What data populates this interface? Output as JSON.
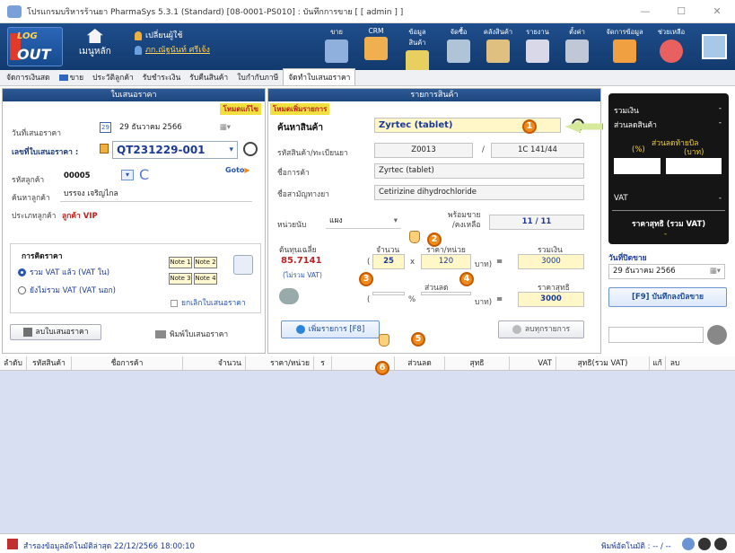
{
  "window": {
    "title": "โปรแกรมบริหารร้านยา PharmaSys 5.3.1 (Standard) [08-0001-PS010] : บันทึกการขาย [ [ admin ] ]",
    "min": "—",
    "max": "☐",
    "close": "✕"
  },
  "toolbar": {
    "logout_top": "LOG",
    "logout_bottom": "OUT",
    "home_label": "เมนูหลัก",
    "change_user": "เปลี่ยนผู้ใช้",
    "user_name": "ภก.ณัฐนันท์ ศรีเจ้ง",
    "items": [
      "ขาย",
      "CRM",
      "ข้อมูลสินค้า",
      "จัดซื้อ",
      "คลังสินค้า",
      "รายงาน",
      "ตั้งค่า",
      "จัดการข้อมูล",
      "ช่วยเหลือ"
    ]
  },
  "tabs": [
    "จัดการเงินสด",
    "ขาย",
    "ประวัติลูกค้า",
    "รับชำระเงิน",
    "รับคืนสินค้า",
    "ใบกำกับภาษี",
    "จัดทำใบเสนอราคา"
  ],
  "left": {
    "header": "ใบเสนอราคา",
    "mode_edit": "โหมดแก้ไข",
    "date_label": "วันที่เสนอราคา",
    "cal_day": "29",
    "date_value": "29  ธันวาคม  2566",
    "doc_label": "เลขที่ใบเสนอราคา :",
    "doc_value": "QT231229-001",
    "cust_code_label": "รหัสลูกค้า",
    "cust_code": "00005",
    "goto": "Goto",
    "cust_name_label": "ค้นหาลูกค้า",
    "cust_name": "บรรจง เจริญไกล",
    "cust_type_label": "ประเภทลูกค้า",
    "cust_type": "ลูกค้า VIP",
    "pricing_title": "การคิดราคา",
    "opt1": "รวม VAT แล้ว (VAT ใน)",
    "opt2": "ยังไม่รวม VAT (VAT นอก)",
    "notes": [
      "Note 1",
      "Note 2",
      "Note 3",
      "Note 4"
    ],
    "cancel_quote": "ยกเลิกใบเสนอราคา",
    "delete_btn": "ลบใบเสนอราคา",
    "print_btn": "พิมพ์ใบเสนอราคา"
  },
  "middle": {
    "header": "รายการสินค้า",
    "mode_add": "โหมดเพิ่มรายการ",
    "search_label": "ค้นหาสินค้า",
    "search_value": "Zyrtec (tablet)",
    "code_label": "รหัสสินค้า/ทะเบียนยา",
    "code": "Z0013",
    "slash": "/",
    "reg": "1C 141/44",
    "trade_label": "ชื่อการค้า",
    "trade": "Zyrtec (tablet)",
    "generic_label": "ชื่อสามัญทางยา",
    "generic": "Cetirizine dihydrochloride",
    "unit_label": "หน่วยนับ",
    "unit": "แผง",
    "ready_label": "พร้อมขาย\n/คงเหลือ",
    "ready_value": "11 / 11",
    "avgcost_label": "ต้นทุนเฉลี่ย",
    "avgcost": "85.7141",
    "novat": "(ไม่รวม VAT)",
    "qty_label": "จำนวน",
    "qty": "25",
    "x": "x",
    "price_label": "ราคา/หน่วย",
    "price": "120",
    "baht": "บาท)",
    "eq": "=",
    "total_label": "รวมเงิน",
    "total": "3000",
    "discount_label": "ส่วนลด",
    "pct": "%",
    "net_label": "ราคาสุทธิ",
    "net": "3000",
    "add_btn": "เพิ่มรายการ [F8]",
    "delete_all": "ลบทุกรายการ"
  },
  "right": {
    "total_label": "รวมเงิน",
    "total_value": "-",
    "disc_label": "ส่วนลดสินค้า",
    "disc_value": "-",
    "end_disc": "ส่วนลดท้ายบิล",
    "pct": "(%)",
    "baht": "(บาท)",
    "vat_label": "VAT",
    "vat_value": "-",
    "net_label": "ราคาสุทธิ (รวม VAT)",
    "net_value": "-",
    "sale_date_label": "วันที่ปิดขาย",
    "sale_date": "29  ธันวาคม   2566",
    "save_btn": "[F9] บันทึกลงบิลขาย"
  },
  "grid": {
    "columns": [
      "ลำดับ",
      "รหัสสินค้า",
      "ชื่อการค้า",
      "จำนวน",
      "ราคา/หน่วย",
      "ร",
      "",
      "ส่วนลด",
      "สุทธิ",
      "VAT",
      "สุทธิ(รวม VAT)",
      "แก้",
      "ลบ"
    ]
  },
  "callouts": [
    "1",
    "2",
    "3",
    "4",
    "5",
    "6"
  ],
  "status": {
    "sync": "สำรองข้อมูลอัตโนมัติล่าสุด  22/12/2566  18:00:10",
    "right": "พิมพ์อัตโนมัติ : -- / --"
  }
}
